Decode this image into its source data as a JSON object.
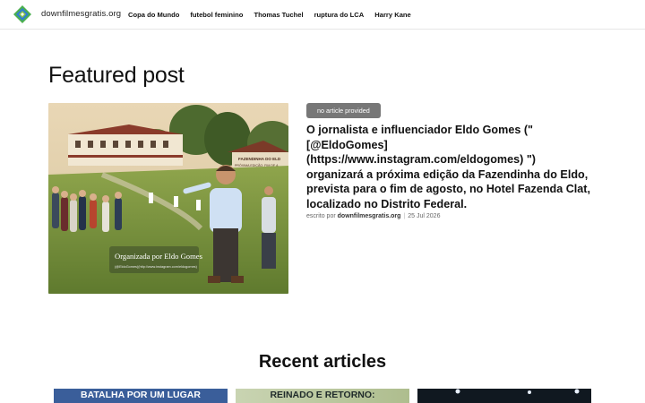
{
  "header": {
    "site_name": "downfilmesgratis.org",
    "logo_icon": "diamond-logo-icon",
    "nav": [
      {
        "label": "Copa do Mundo"
      },
      {
        "label": "futebol feminino"
      },
      {
        "label": "Thomas Tuchel"
      },
      {
        "label": "ruptura do LCA"
      },
      {
        "label": "Harry Kane"
      }
    ]
  },
  "featured": {
    "heading": "Featured post",
    "badge": "no article provided",
    "title": "O jornalista e influenciador Eldo Gomes (\"[@EldoGomes](https://www.instagram.com/eldogomes) \") organizará a próxima edição da Fazendinha do Eldo, prevista para o fim de agosto, no Hotel Fazenda Clat, localizado no Distrito Federal.",
    "byline_prefix": "escrito por",
    "author": "downfilmesgratis.org",
    "separator": "|",
    "date": "25 Jul 2026",
    "image": {
      "caption": "Organizada por Eldo Gomes",
      "subcaption": "(@EldoGomes)(http://www.instagram.com/eldogomes)",
      "sign": "FAZENDINHA DO ELDO – PRÓXIMA EDIÇÃO: FIM DE A..."
    }
  },
  "recent": {
    "heading": "Recent articles",
    "cards": [
      {
        "text": "BATALHA POR UM LUGAR",
        "text_color": "#ffffff",
        "bg": "#3a5e9a"
      },
      {
        "text": "REINADO E RETORNO:",
        "text_color": "#1f2a2a",
        "bg": "#b9c6a2"
      },
      {
        "text": "",
        "text_color": "#ffffff",
        "bg": "#101820"
      }
    ]
  },
  "colors": {
    "badge_bg": "#777777",
    "header_border": "#e6e6e6",
    "logo_green": "#4caf50",
    "logo_blue": "#2f7fd0"
  }
}
